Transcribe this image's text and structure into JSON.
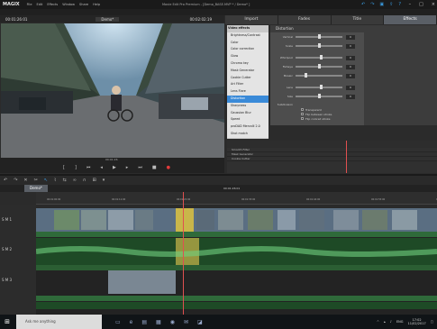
{
  "titlebar": {
    "app": "MAGIX",
    "menu": [
      "File",
      "Edit",
      "Effects",
      "Window",
      "Share",
      "Help"
    ],
    "window_title": "Movie Edit Pro Premium - [Demo_BASE.MVP * / Demo* ]"
  },
  "monitor": {
    "tc_left": "00:01:26:01",
    "tab": "Demo*",
    "tc_right": "00:02:02:19",
    "tc_bar": "00:01:26"
  },
  "panel_tabs": [
    "Import",
    "Fades",
    "Title",
    "Effects"
  ],
  "effects": {
    "list": [
      {
        "label": "Video effects",
        "type": "cat"
      },
      {
        "label": "Brightness/Contrast"
      },
      {
        "label": "Color"
      },
      {
        "label": "Color correction"
      },
      {
        "label": "Glow"
      },
      {
        "label": "Chroma key"
      },
      {
        "label": "Mask Generator"
      },
      {
        "label": "Cookie Cutter"
      },
      {
        "label": "Art Filter"
      },
      {
        "label": "Lens Flare"
      },
      {
        "label": "Distortion",
        "selected": true
      },
      {
        "label": "Sharpness"
      },
      {
        "label": "Gaussian Blur"
      },
      {
        "label": "Speed"
      },
      {
        "label": "proDAD Mercalli 2.0"
      },
      {
        "label": "Shot match"
      },
      {
        "label": "View/Animation",
        "type": "cat"
      },
      {
        "label": "Auto Fixation"
      },
      {
        "label": "Stabilization"
      },
      {
        "label": "Stereo3D"
      }
    ],
    "panel_title": "Distortion",
    "sliders": [
      {
        "label": "Vertical",
        "value": "0"
      },
      {
        "label": "Scale",
        "value": "0"
      },
      {
        "label": "Whirlpool",
        "value": "0"
      },
      {
        "label": "Fisheye",
        "value": "0"
      },
      {
        "label": "Mosaic",
        "value": "0"
      },
      {
        "label": "Lens",
        "value": "0"
      },
      {
        "label": "Size",
        "value": "0"
      }
    ],
    "subsection": "Subdivision",
    "checks": [
      "Transparent",
      "Flip between stroke",
      "Flip colored stroke"
    ],
    "keyframe_rows": [
      "Smooth Filter",
      "Mask Generator",
      "Cookie Cutter"
    ]
  },
  "timeline": {
    "tab": "Demo*",
    "timecode": "00:01:26:01",
    "ruler": [
      "00:01:00:00",
      "00:01:11:00",
      "00:01:22:00",
      "00:01:33:00",
      "00:01:44:00",
      "00:01:55:00",
      "00:02:06:00"
    ],
    "tracks": [
      "1",
      "2",
      "3"
    ],
    "track_flags": "S M"
  },
  "taskbar": {
    "search_placeholder": "Ask me anything",
    "tray_lang": "ENG",
    "time": "17:02",
    "date": "11/02/2017"
  }
}
